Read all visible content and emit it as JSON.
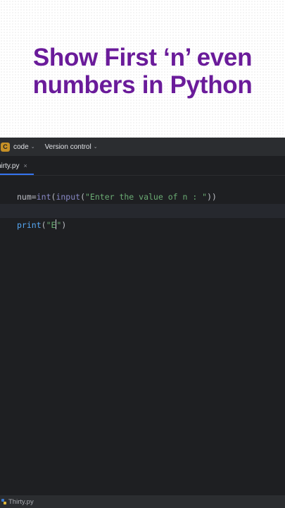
{
  "headline": {
    "line1": "Show First ‘n’ even",
    "line2": "numbers in Python"
  },
  "ide": {
    "project_badge": "C",
    "project_name": "code",
    "version_control": "Version control",
    "chevron": "⌄",
    "tab_label": "hirty.py",
    "tab_close": "×",
    "code": {
      "line1": [
        {
          "text": "num",
          "kind": "ident"
        },
        {
          "text": "=",
          "kind": "ident"
        },
        {
          "text": "int",
          "kind": "builtin"
        },
        {
          "text": "(",
          "kind": "ident"
        },
        {
          "text": "input",
          "kind": "builtin"
        },
        {
          "text": "(",
          "kind": "ident"
        },
        {
          "text": "\"Enter the value of n : \"",
          "kind": "str"
        },
        {
          "text": "))",
          "kind": "ident"
        }
      ],
      "line3_print": "print",
      "line3_open": "(",
      "line3_str_open": "\"E",
      "line3_str_close": "\"",
      "line3_close": ")"
    },
    "status_file": "Thirty.py",
    "colors": {
      "accent": "#3574f0",
      "headline": "#6a1b9a",
      "editor_bg": "#1e1f22"
    }
  }
}
